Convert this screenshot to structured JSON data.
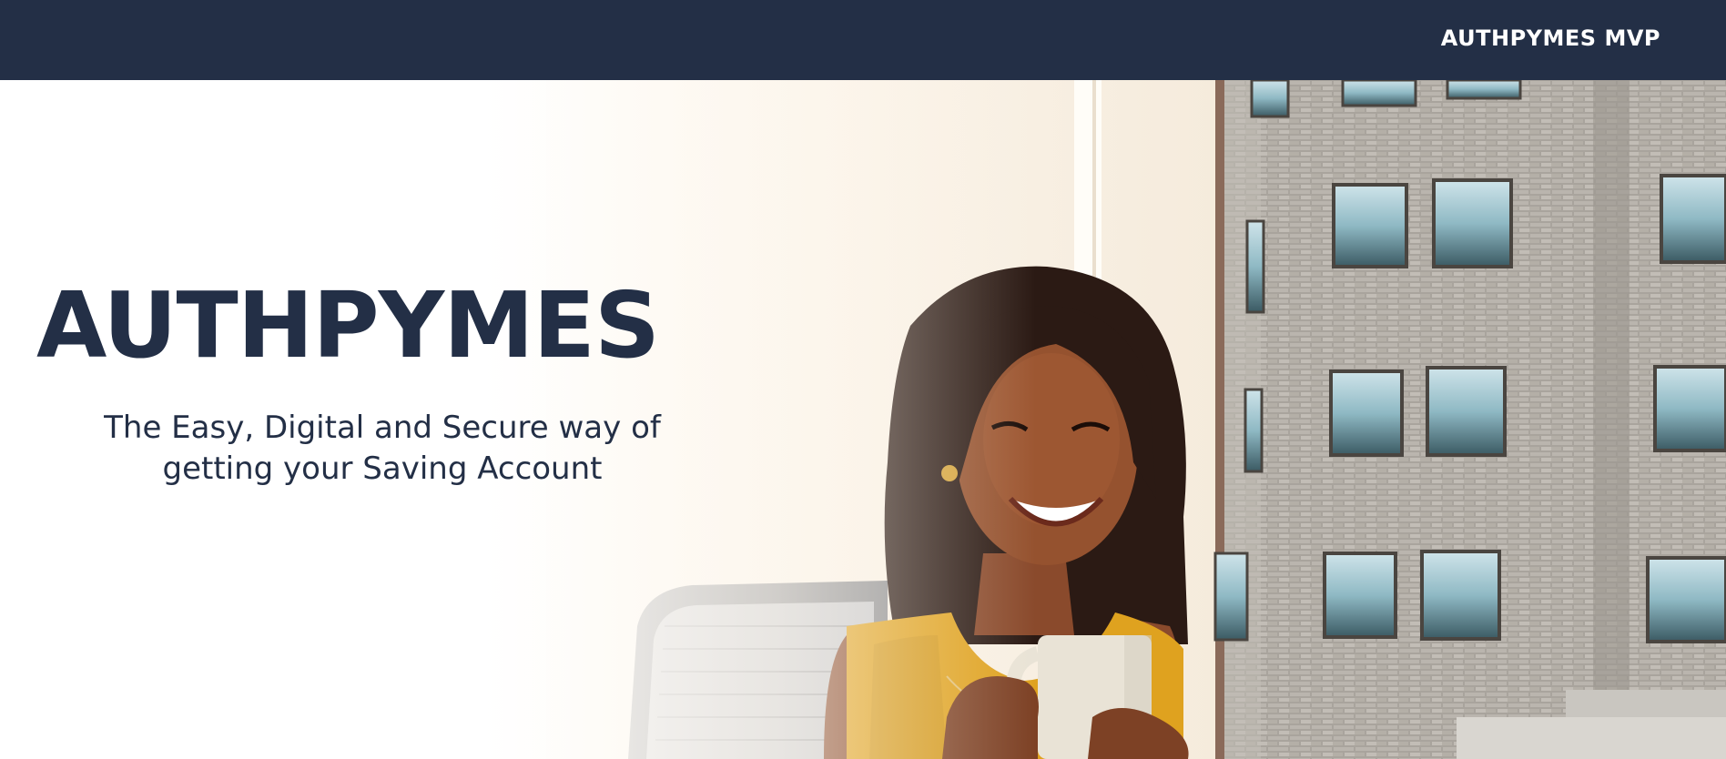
{
  "navbar": {
    "brand": "AUTHPYMES MVP",
    "background_color": "#232f46"
  },
  "hero": {
    "title": "AUTHPYMES",
    "subtitle": "The Easy, Digital and Secure way of getting your Saving Account",
    "text_color": "#232f46",
    "image": "smiling-woman-holding-mug-photo"
  }
}
